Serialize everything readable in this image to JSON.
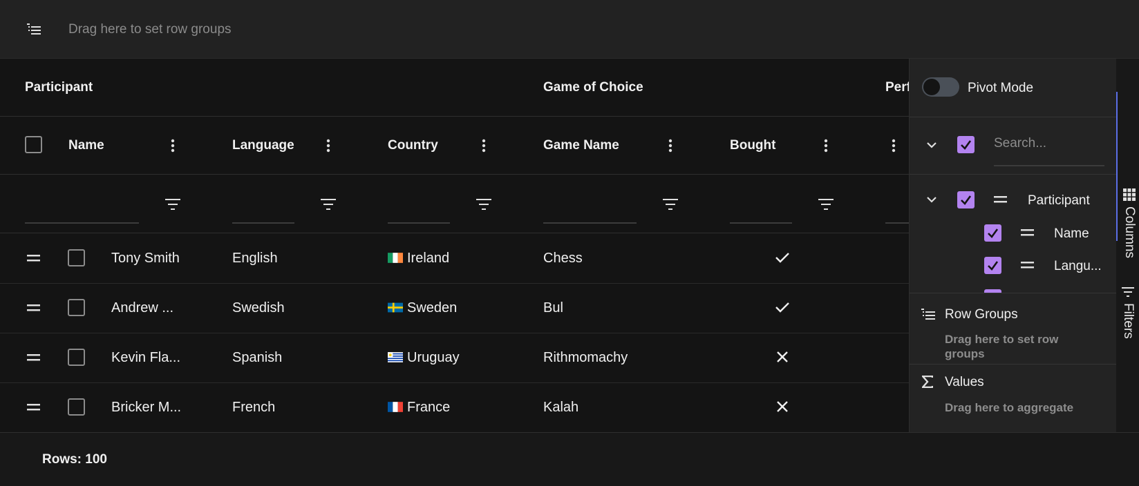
{
  "row_group_zone": {
    "placeholder": "Drag here to set row groups",
    "icon": "row-group-icon"
  },
  "header_groups": [
    "Participant",
    "Game of Choice",
    "Perf"
  ],
  "columns": [
    "Name",
    "Language",
    "Country",
    "Game Name",
    "Bought"
  ],
  "rows": [
    {
      "name": "Tony Smith",
      "language": "English",
      "country": "Ireland",
      "flag": "ireland",
      "game": "Chess",
      "bought": true
    },
    {
      "name": "Andrew ...",
      "language": "Swedish",
      "country": "Sweden",
      "flag": "sweden",
      "game": "Bul",
      "bought": true
    },
    {
      "name": "Kevin Fla...",
      "language": "Spanish",
      "country": "Uruguay",
      "flag": "uruguay",
      "game": "Rithmomachy",
      "bought": false
    },
    {
      "name": "Bricker M...",
      "language": "French",
      "country": "France",
      "flag": "france",
      "game": "Kalah",
      "bought": false
    }
  ],
  "status_bar": {
    "rows_text": "Rows: 100"
  },
  "tool_panel": {
    "pivot_mode_label": "Pivot Mode",
    "pivot_mode_on": false,
    "search_placeholder": "Search...",
    "column_tree": [
      {
        "label": "Participant",
        "checked": true,
        "expanded": true
      },
      {
        "label": "Name",
        "checked": true
      },
      {
        "label": "Langu...",
        "checked": true
      }
    ],
    "row_groups": {
      "title": "Row Groups",
      "hint": "Drag here to set row groups"
    },
    "values": {
      "title": "Values",
      "hint": "Drag here to aggregate"
    }
  },
  "side_bar": {
    "tabs": [
      "Columns",
      "Filters"
    ],
    "active": "Columns"
  },
  "colors": {
    "accent": "#b383f0",
    "active_tab": "#5b6ee6",
    "background": "#141414"
  }
}
